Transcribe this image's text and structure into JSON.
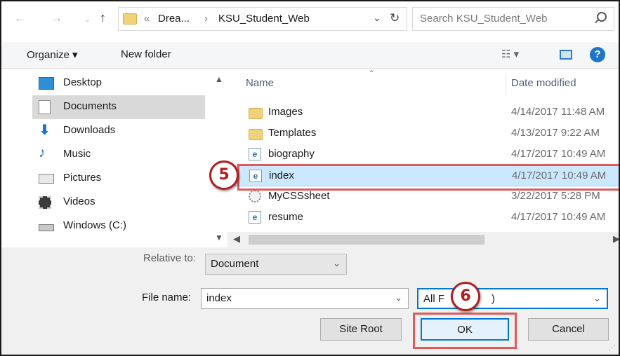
{
  "address_bar": {
    "back_icon": "arrow-left-icon",
    "forward_icon": "arrow-right-icon",
    "recent_icon": "chevron-down-icon",
    "up_icon": "arrow-up-icon",
    "overflow": "«",
    "crumb_1": "Drea...",
    "separator": "›",
    "crumb_2": "KSU_Student_Web",
    "dropdown_glyph": "⌄",
    "refresh_glyph": "↻",
    "search_placeholder": "Search KSU_Student_Web"
  },
  "toolbar": {
    "organize": "Organize ▾",
    "new_folder": "New folder",
    "view_glyph": "☷ ▾",
    "help": "?"
  },
  "nav_pane": {
    "items": [
      {
        "label": "Desktop",
        "icon": "desktop-icon"
      },
      {
        "label": "Documents",
        "icon": "documents-icon",
        "selected": true
      },
      {
        "label": "Downloads",
        "icon": "download-arrow-icon"
      },
      {
        "label": "Music",
        "icon": "music-note-icon"
      },
      {
        "label": "Pictures",
        "icon": "pictures-icon"
      },
      {
        "label": "Videos",
        "icon": "film-icon"
      },
      {
        "label": "Windows (C:)",
        "icon": "drive-icon"
      }
    ]
  },
  "file_list": {
    "columns": {
      "name": "Name",
      "date": "Date modified"
    },
    "rows": [
      {
        "name": "Images",
        "date": "4/14/2017 11:48 AM",
        "icon": "folder-icon"
      },
      {
        "name": "Templates",
        "date": "4/13/2017 9:22 AM",
        "icon": "folder-icon"
      },
      {
        "name": "biography",
        "date": "4/17/2017 10:49 AM",
        "icon": "html-file-icon"
      },
      {
        "name": "index",
        "date": "4/17/2017 10:49 AM",
        "icon": "html-file-icon",
        "selected": true
      },
      {
        "name": "MyCSSsheet",
        "date": "3/22/2017 5:28 PM",
        "icon": "css-file-icon"
      },
      {
        "name": "resume",
        "date": "4/17/2017 10:49 AM",
        "icon": "html-file-icon"
      }
    ]
  },
  "form": {
    "relative_label": "Relative to:",
    "relative_value": "Document",
    "filename_label": "File name:",
    "filename_value": "index",
    "filetype_value_start": "All F",
    "filetype_value_end": ")",
    "site_root": "Site Root",
    "ok": "OK",
    "cancel": "Cancel"
  },
  "callouts": {
    "step_5": "5",
    "step_6": "6",
    "color": "#b01e1e"
  }
}
